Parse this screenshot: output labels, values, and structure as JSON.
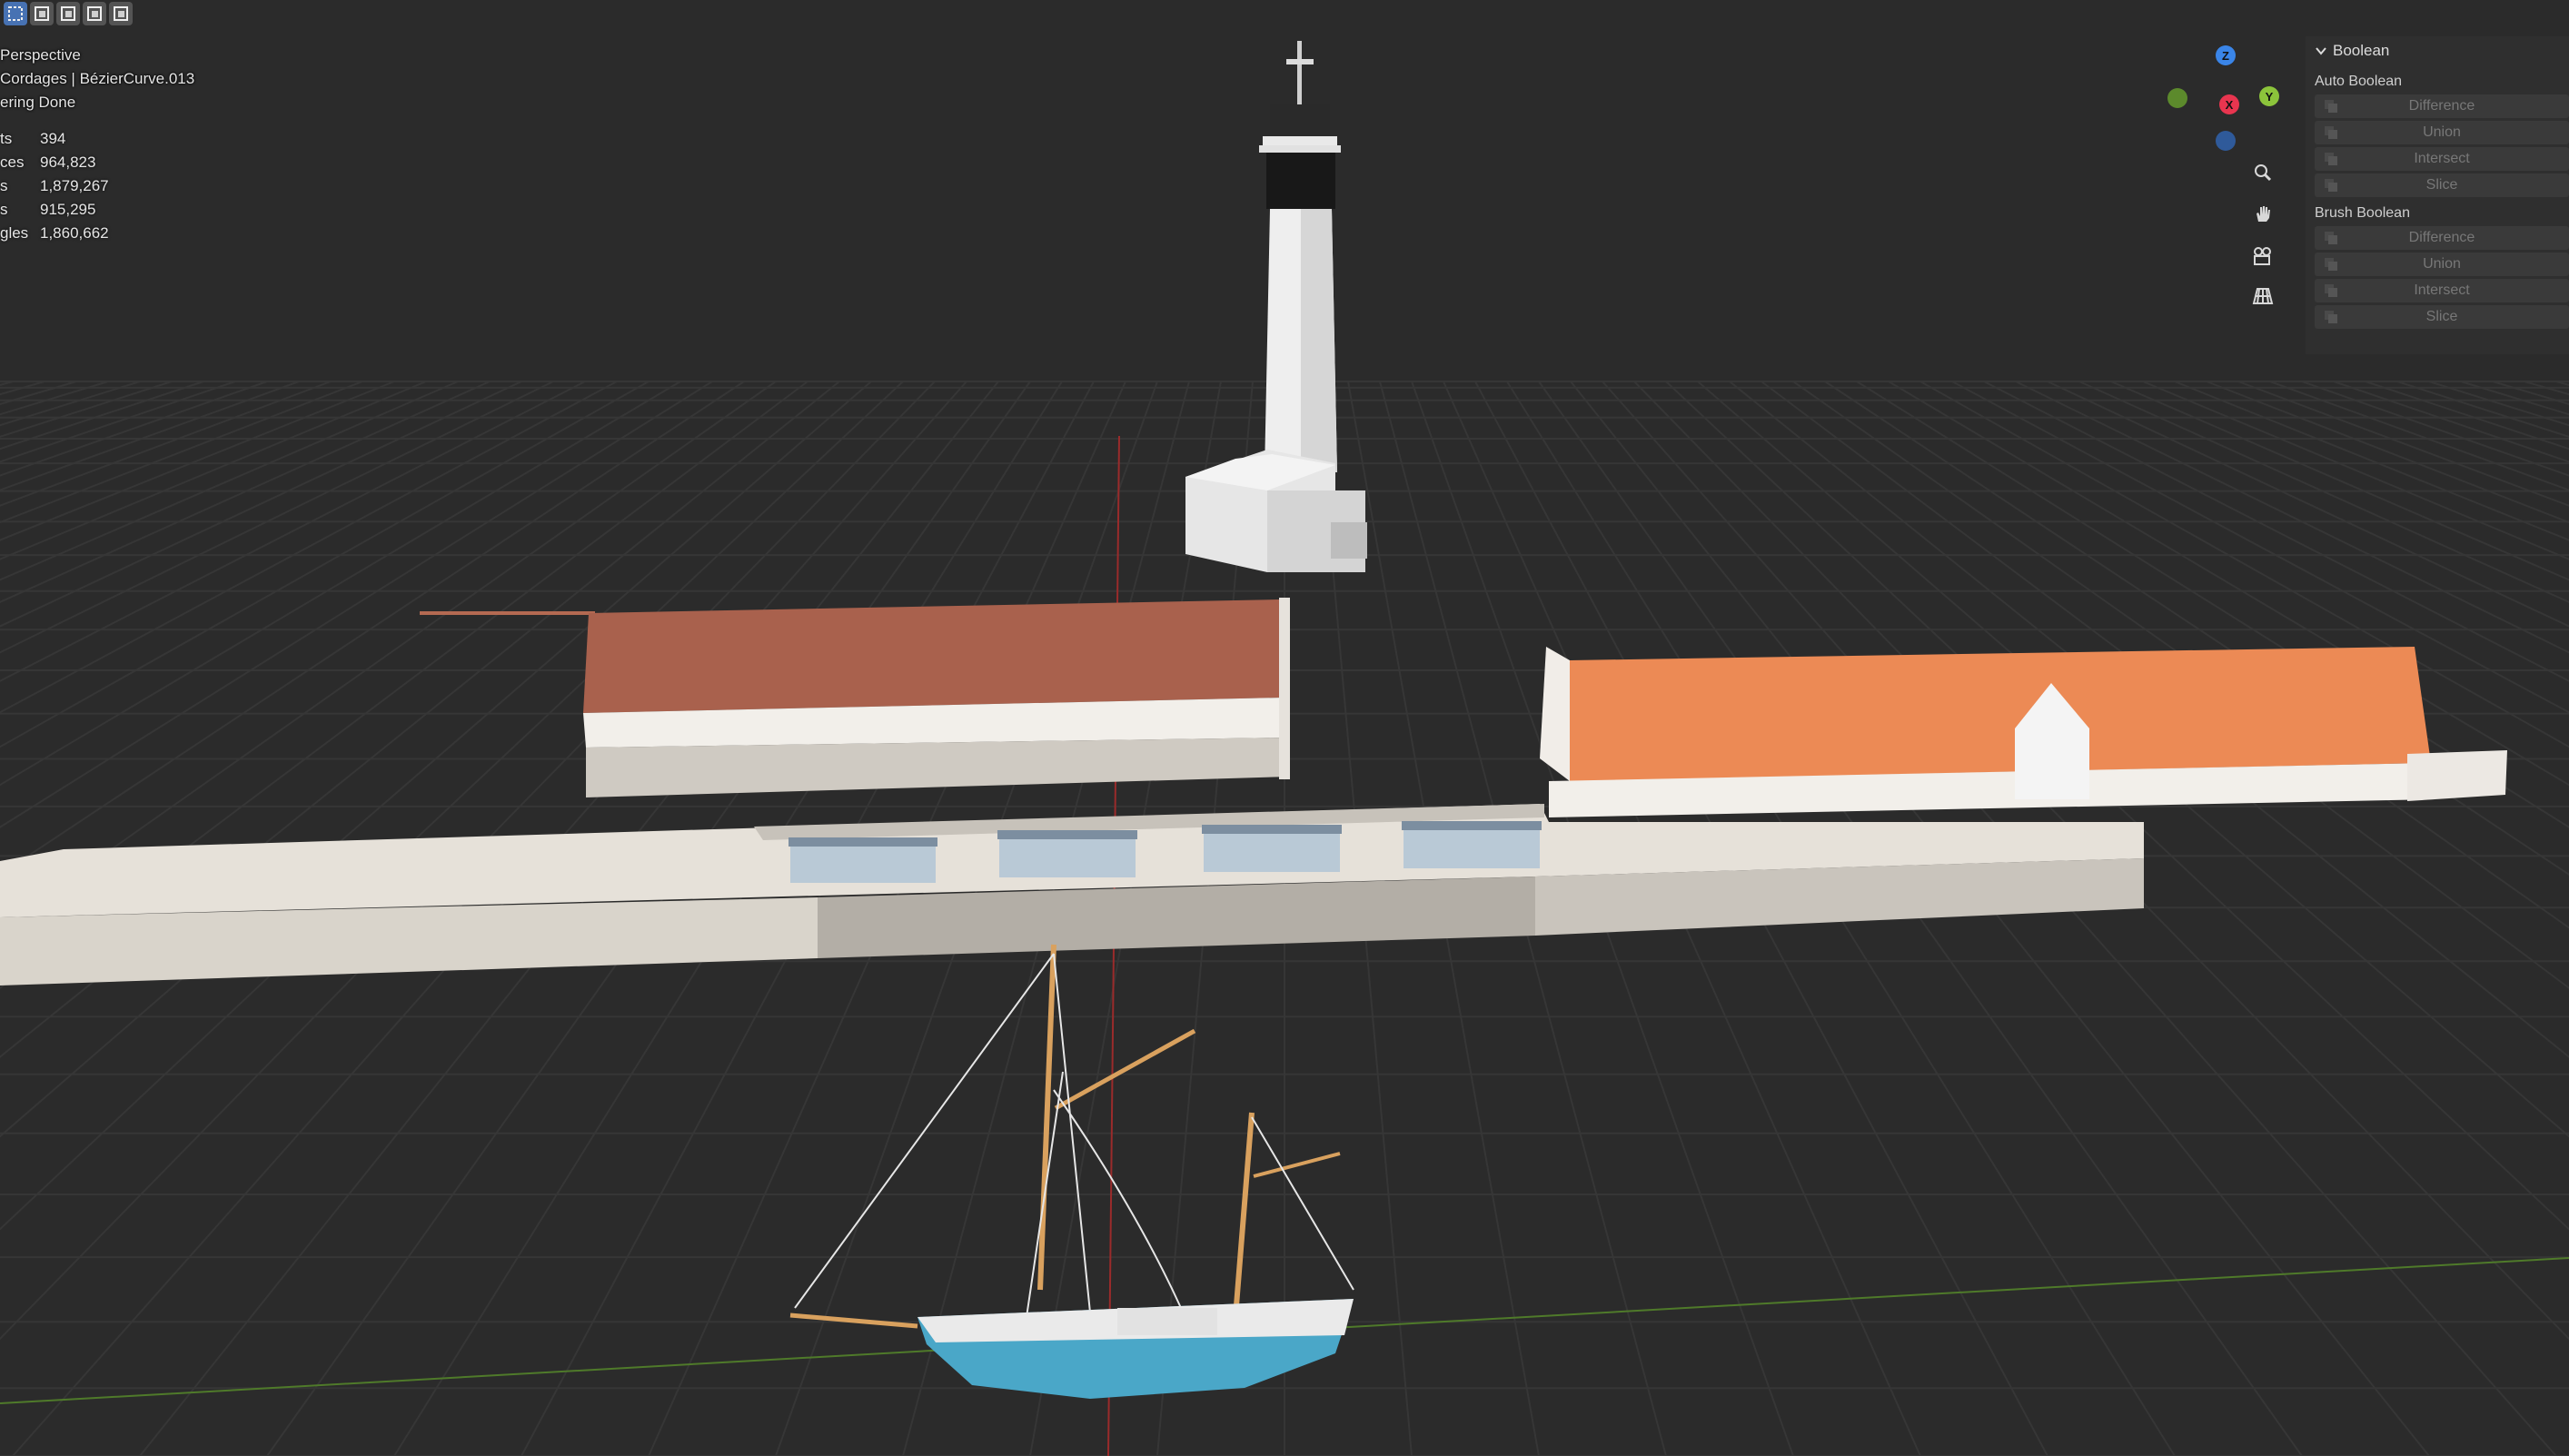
{
  "toolbar": {
    "modes": [
      {
        "icon": "select-box-icon",
        "active": true
      },
      {
        "icon": "extend-selection-icon",
        "active": false
      },
      {
        "icon": "subtract-selection-icon",
        "active": false
      },
      {
        "icon": "invert-selection-icon",
        "active": false
      },
      {
        "icon": "intersect-selection-icon",
        "active": false
      }
    ]
  },
  "overlay": {
    "view_name": "Perspective",
    "object_path": " Cordages | BézierCurve.013",
    "status": "ering Done",
    "stats": [
      {
        "label": "ts",
        "value": "394"
      },
      {
        "label": "ces",
        "value": "964,823"
      },
      {
        "label": "s",
        "value": "1,879,267"
      },
      {
        "label": "s",
        "value": "915,295"
      },
      {
        "label": "gles",
        "value": "1,860,662"
      }
    ]
  },
  "gizmo": {
    "axes": {
      "z": "Z",
      "x": "X",
      "y": "Y"
    },
    "colors": {
      "x": "#e8354f",
      "y": "#8cc43b",
      "z": "#3a85e8",
      "neg_y": "#5c8a2c",
      "neg_z": "#2f5a9a"
    },
    "nav_icons": [
      "zoom-icon",
      "pan-hand-icon",
      "camera-icon",
      "grid-perspective-icon"
    ]
  },
  "panel": {
    "title": "Boolean",
    "sections": [
      {
        "title": "Auto Boolean",
        "buttons": [
          "Difference",
          "Union",
          "Intersect",
          "Slice"
        ]
      },
      {
        "title": "Brush Boolean",
        "buttons": [
          "Difference",
          "Union",
          "Intersect",
          "Slice"
        ]
      }
    ]
  },
  "scene": {
    "grid_color": "#363636",
    "background": "#2b2b2b",
    "roof_left": "#a9614d",
    "roof_right": "#ec8a55",
    "hull": "#4aa7c8",
    "mast": "#d9a15e"
  }
}
